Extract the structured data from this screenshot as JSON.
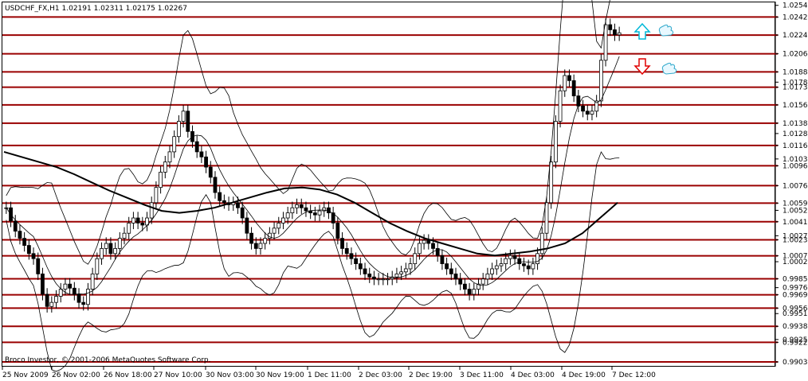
{
  "chart_data": {
    "type": "candlestick",
    "title": "USDCHF_FX,H1  1.02191 1.02311 1.02175 1.02267",
    "copyright": "Broco Investor, © 2001-2006 MetaQuotes Software Corp.",
    "x_labels": [
      "25 Nov 2009",
      "26 Nov 02:00",
      "26 Nov 18:00",
      "27 Nov 10:00",
      "30 Nov 03:00",
      "30 Nov 19:00",
      "1 Dec 11:00",
      "2 Dec 03:00",
      "2 Dec 19:00",
      "3 Dec 11:00",
      "4 Dec 03:00",
      "4 Dec 19:00",
      "7 Dec 12:00"
    ],
    "ylim": [
      0.99035,
      1.0253
    ],
    "y_ticks": [
      "1.02540",
      "1.02425",
      "1.02248",
      "1.02064",
      "1.01886",
      "1.01785",
      "1.01735",
      "1.01561",
      "1.01382",
      "1.01280",
      "1.01163",
      "1.01030",
      "1.00963",
      "1.00768",
      "1.00596",
      "1.00525",
      "1.00413",
      "1.00275",
      "1.00235",
      "1.00078",
      "1.00020",
      "0.99852",
      "0.99765",
      "0.99695",
      "0.99510",
      "0.99564",
      "0.99385",
      "0.99255",
      "0.99228",
      "0.99035"
    ],
    "level_lines": [
      "1.02425",
      "1.02248",
      "1.02064",
      "1.01886",
      "1.01735",
      "1.01561",
      "1.01382",
      "1.01163",
      "1.00963",
      "1.00768",
      "1.00596",
      "1.00413",
      "1.00235",
      "1.00078",
      "0.99852",
      "0.99695",
      "0.99564",
      "0.99385",
      "0.99228",
      "0.99035"
    ],
    "closes": [
      1.0055,
      1.0042,
      1.0032,
      1.0025,
      1.0018,
      1.001,
      1.0005,
      0.999,
      0.997,
      0.9958,
      0.9962,
      0.9968,
      0.9975,
      0.998,
      0.9976,
      0.997,
      0.9962,
      0.996,
      0.9975,
      0.999,
      1.0005,
      1.0015,
      1.002,
      1.001,
      1.0015,
      1.0025,
      1.003,
      1.004,
      1.0045,
      1.004,
      1.0038,
      1.0045,
      1.006,
      1.0075,
      1.009,
      1.01,
      1.011,
      1.0125,
      1.014,
      1.015,
      1.013,
      1.012,
      1.011,
      1.0105,
      1.0095,
      1.0085,
      1.007,
      1.0062,
      1.006,
      1.0058,
      1.006,
      1.0055,
      1.0045,
      1.003,
      1.002,
      1.0015,
      1.002,
      1.0025,
      1.003,
      1.0035,
      1.004,
      1.0045,
      1.005,
      1.0055,
      1.0058,
      1.0055,
      1.0052,
      1.005,
      1.0048,
      1.0052,
      1.0055,
      1.005,
      1.004,
      1.0025,
      1.0015,
      1.001,
      1.0005,
      1.0,
      0.9995,
      0.999,
      0.9987,
      0.9985,
      0.9985,
      0.9985,
      0.9985,
      0.9987,
      0.999,
      0.9992,
      0.9995,
      1.0,
      1.001,
      1.002,
      1.0023,
      1.002,
      1.0015,
      1.0008,
      1.0,
      0.9995,
      0.999,
      0.9985,
      0.998,
      0.9975,
      0.997,
      0.9975,
      0.998,
      0.9985,
      0.999,
      0.9995,
      0.9998,
      1.0,
      1.0005,
      1.0008,
      1.0005,
      1.0,
      0.9998,
      0.9995,
      1.0,
      1.001,
      1.003,
      1.006,
      1.01,
      1.014,
      1.017,
      1.0185,
      1.018,
      1.0165,
      1.0155,
      1.015,
      1.0147,
      1.015,
      1.016,
      1.02,
      1.0235,
      1.023,
      1.0225,
      1.0227
    ],
    "ma_slow": [
      1.011,
      1.0105,
      1.01,
      1.0095,
      1.0088,
      1.008,
      1.0072,
      1.0065,
      1.0058,
      1.0052,
      1.005,
      1.0052,
      1.0055,
      1.006,
      1.0065,
      1.007,
      1.0074,
      1.0075,
      1.0073,
      1.0068,
      1.006,
      1.005,
      1.004,
      1.0032,
      1.0025,
      1.002,
      1.0015,
      1.001,
      1.0008,
      1.001,
      1.0012,
      1.0015,
      1.002,
      1.003,
      1.0045,
      1.006
    ],
    "series": [
      {
        "name": "USDCHF_FX,H1"
      }
    ]
  }
}
